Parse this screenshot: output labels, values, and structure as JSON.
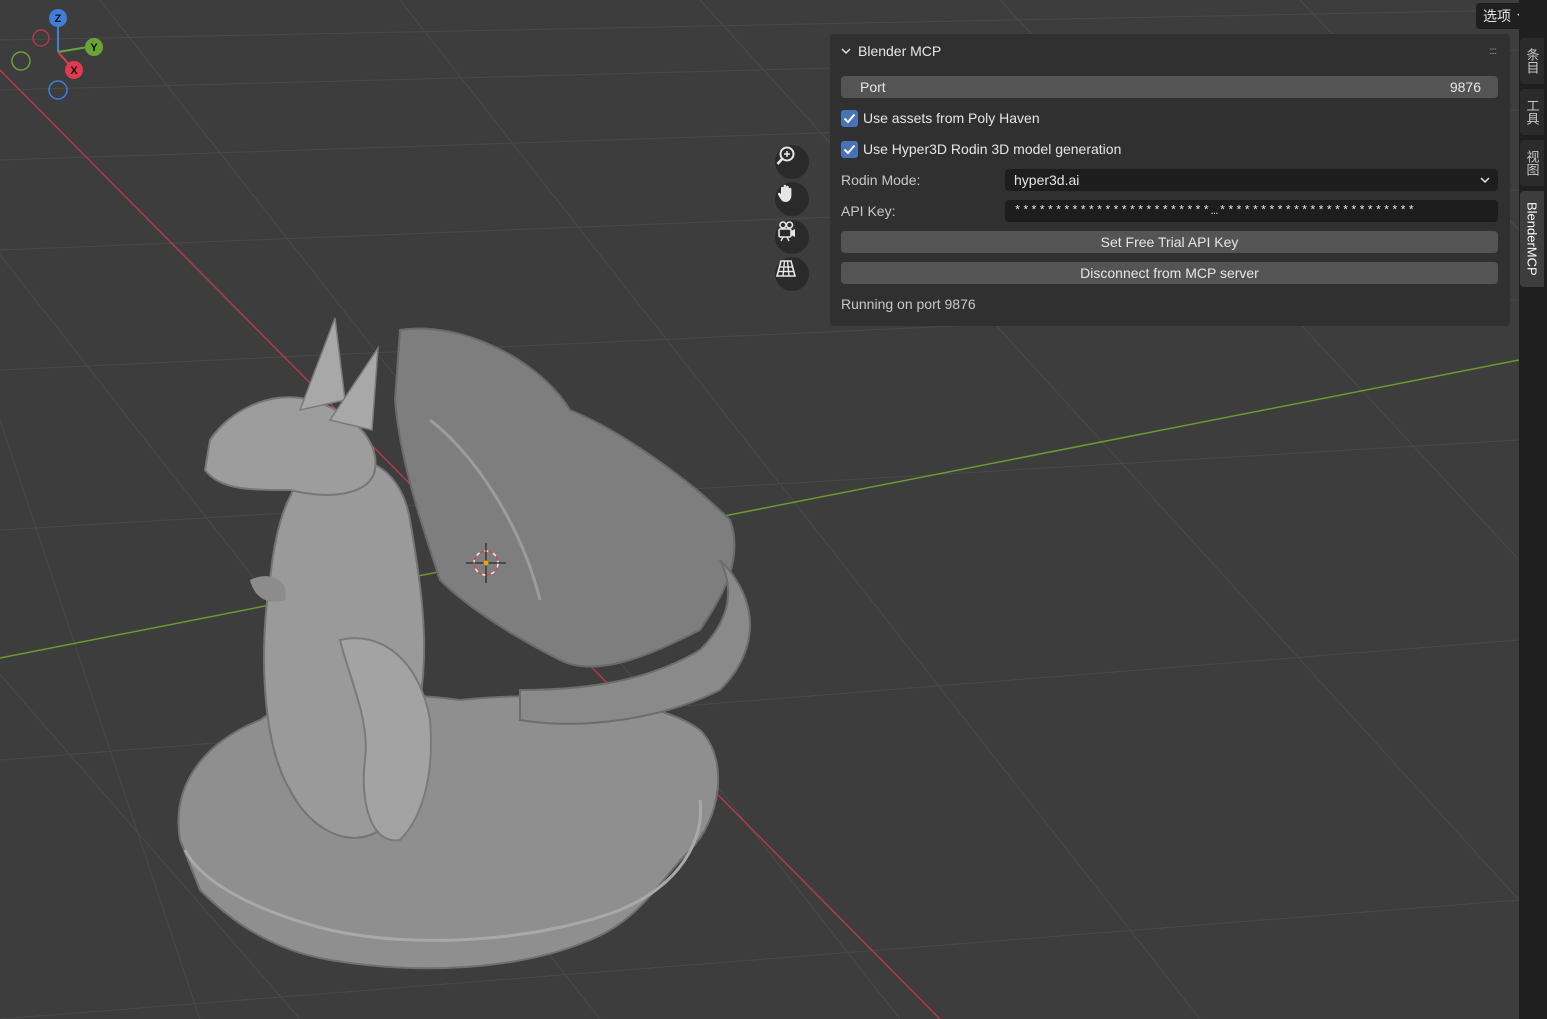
{
  "header": {
    "options_label": "选项"
  },
  "gizmo": {
    "z": "Z",
    "y": "Y",
    "x": "X"
  },
  "nav_icons": [
    "zoom-icon",
    "hand-pan-icon",
    "camera-icon",
    "grid-perspective-icon"
  ],
  "panel": {
    "title": "Blender MCP",
    "port_label": "Port",
    "port_value": "9876",
    "poly_haven_label": "Use assets from Poly Haven",
    "poly_haven_checked": true,
    "hyper3d_label": "Use Hyper3D Rodin 3D model generation",
    "hyper3d_checked": true,
    "rodin_mode_label": "Rodin Mode:",
    "rodin_mode_value": "hyper3d.ai",
    "api_key_label": "API Key:",
    "api_key_value": "************************…************************",
    "free_trial_button": "Set Free Trial API Key",
    "disconnect_button": "Disconnect from MCP server",
    "status": "Running on port 9876"
  },
  "sidebar_tabs": [
    {
      "label": "条目",
      "active": false
    },
    {
      "label": "工具",
      "active": false
    },
    {
      "label": "视图",
      "active": false
    },
    {
      "label": "BlenderMCP",
      "active": true
    }
  ],
  "colors": {
    "accent": "#4772b3",
    "x_axis": "#e03a4f",
    "y_axis": "#6aa336",
    "z_axis": "#3d7fdb",
    "viewport_bg": "#3d3d3d"
  }
}
